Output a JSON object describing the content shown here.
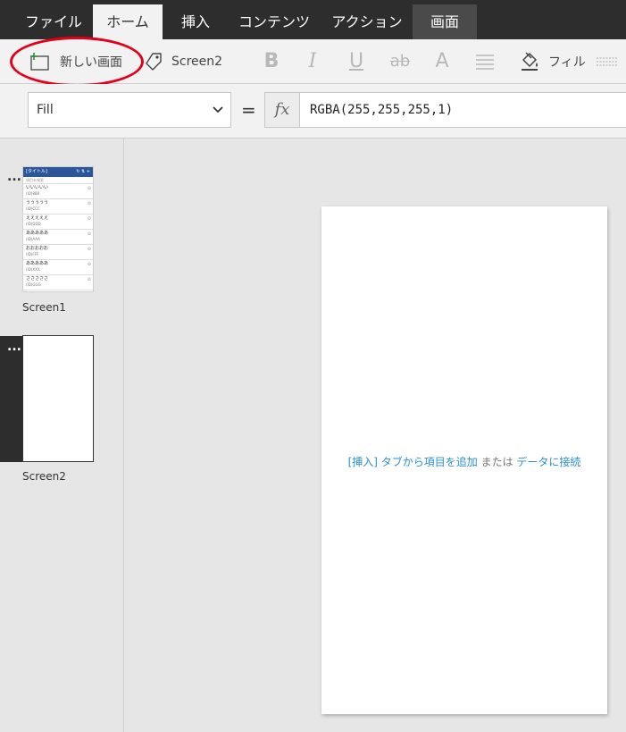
{
  "tabs": [
    {
      "label": "ファイル",
      "active": false
    },
    {
      "label": "ホーム",
      "active": true
    },
    {
      "label": "挿入",
      "active": false
    },
    {
      "label": "コンテンツ",
      "active": false
    },
    {
      "label": "アクション",
      "active": false
    },
    {
      "label": "画面",
      "active": false,
      "contextual": true
    }
  ],
  "ribbon": {
    "new_screen_label": "新しい画面",
    "screen_name": "Screen2",
    "bold": "B",
    "italic": "I",
    "underline": "U",
    "strikethrough": "ab",
    "font_size": "A",
    "fill_label": "フィル"
  },
  "formula_bar": {
    "property": "Fill",
    "equals": "=",
    "fx": "fx",
    "formula": "RGBA(255,255,255,1)"
  },
  "screens": [
    {
      "name": "Screen1",
      "menu": "...",
      "preview": {
        "title": "[タイトル]",
        "header_icons": "↻ ⇅ +",
        "search_placeholder": "項目を検索",
        "rows": [
          {
            "a": "いいいいい",
            "b": "(ID)888"
          },
          {
            "a": "ううううう",
            "b": "(ID)CCC"
          },
          {
            "a": "えええええ",
            "b": "(ID)DDD"
          },
          {
            "a": "あああああ",
            "b": "(ID)AAA"
          },
          {
            "a": "おおおおお",
            "b": "(ID)FFF"
          },
          {
            "a": "あああああ",
            "b": "(ID)XXX"
          },
          {
            "a": "さささささ",
            "b": "(ID)GGG"
          }
        ],
        "row_icon": "⊘"
      }
    },
    {
      "name": "Screen2",
      "menu": "...",
      "selected": true
    }
  ],
  "canvas": {
    "hint_link1": "[挿入] タブから項目を追加",
    "hint_or": "または",
    "hint_link2": "データに接続"
  },
  "colors": {
    "tabbar": "#2d2d2d",
    "annotation": "#e2001a",
    "link": "#2b8fd3"
  }
}
